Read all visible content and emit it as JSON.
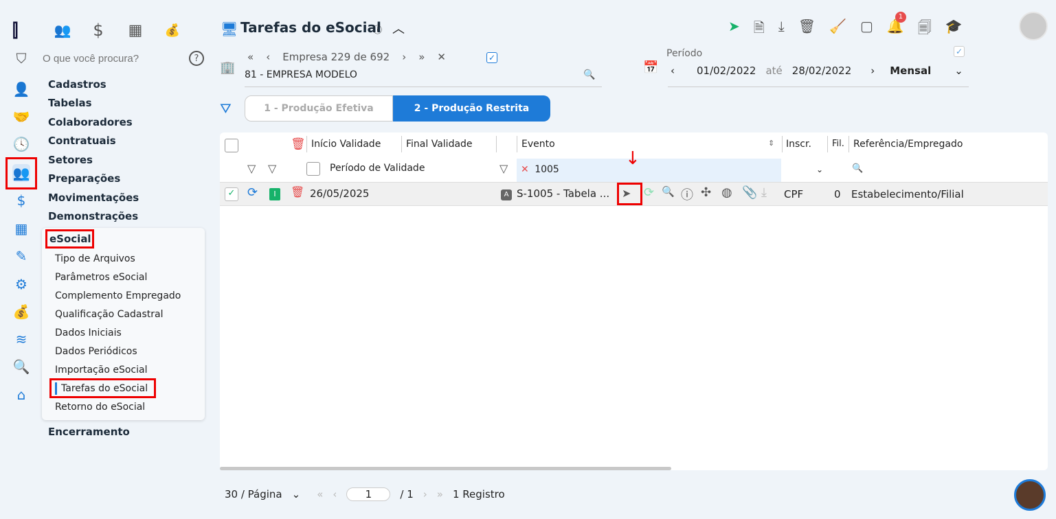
{
  "app": {
    "title": "Tarefas do eSocial",
    "search_placeholder": "O que você procura?"
  },
  "rail": [
    "logo",
    "people-icon",
    "dollar-icon",
    "calculator-icon",
    "money-bag-icon"
  ],
  "sidebar": {
    "items": [
      "Cadastros",
      "Tabelas",
      "Colaboradores",
      "Contratuais",
      "Setores",
      "Preparações",
      "Movimentações",
      "Demonstrações"
    ],
    "esocial": {
      "label": "eSocial",
      "items": [
        "Tipo de Arquivos",
        "Parâmetros eSocial",
        "Complemento Empregado",
        "Qualificação Cadastral",
        "Dados Iniciais",
        "Dados Periódicos",
        "Importação eSocial",
        "Tarefas do eSocial",
        "Retorno do eSocial"
      ]
    },
    "last": "Encerramento"
  },
  "company": {
    "nav": "Empresa 229 de 692",
    "value": "81 - EMPRESA MODELO"
  },
  "period": {
    "label": "Período",
    "from": "01/02/2022",
    "sep": "até",
    "to": "28/02/2022",
    "mode": "Mensal"
  },
  "tabs": [
    "1 - Produção Efetiva",
    "2 - Produção Restrita"
  ],
  "notifications": {
    "count": "1"
  },
  "table": {
    "headers": [
      "Início Validade",
      "Final Validade",
      "Evento",
      "Inscr.",
      "Fil.",
      "Referência/Empregado"
    ],
    "filters": {
      "period": "Período de Validade",
      "evento": "1005"
    },
    "rows": [
      {
        "status": "I",
        "inicio": "26/05/2025",
        "badge": "A",
        "evento": "S-1005 - Tabela ...",
        "inscr": "CPF",
        "fil": "0",
        "ref": "Estabelecimento/Filial"
      }
    ]
  },
  "pagination": {
    "per_page": "30 / Página",
    "page": "1",
    "total": "/ 1",
    "records": "1 Registro"
  },
  "colors": {
    "accent": "#1e7bd8",
    "highlight": "#e00000",
    "green": "#17b26a"
  }
}
